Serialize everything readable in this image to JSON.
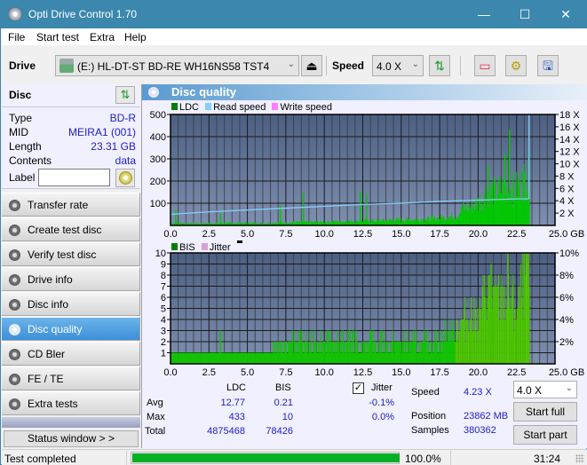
{
  "window": {
    "title": "Opti Drive Control 1.70",
    "controls": {
      "minimize": "—",
      "maximize": "☐",
      "close": "✕"
    }
  },
  "menu": [
    "File",
    "Start test",
    "Extra",
    "Help"
  ],
  "toolbar": {
    "drive_label": "Drive",
    "drive_value": "(E:)  HL-DT-ST BD-RE  WH16NS58 TST4",
    "speed_label": "Speed",
    "speed_value": "4.0 X",
    "icons": [
      "eject-icon",
      "refresh-icon",
      "erase-icon",
      "settings-icon",
      "save-icon"
    ]
  },
  "disc": {
    "header": "Disc",
    "rows": [
      {
        "key": "Type",
        "value": "BD-R"
      },
      {
        "key": "MID",
        "value": "MEIRA1 (001)"
      },
      {
        "key": "Length",
        "value": "23.31 GB"
      },
      {
        "key": "Contents",
        "value": "data"
      }
    ],
    "label_key": "Label",
    "label_value": ""
  },
  "nav": [
    {
      "label": "Transfer rate",
      "active": false
    },
    {
      "label": "Create test disc",
      "active": false
    },
    {
      "label": "Verify test disc",
      "active": false
    },
    {
      "label": "Drive info",
      "active": false
    },
    {
      "label": "Disc info",
      "active": false
    },
    {
      "label": "Disc quality",
      "active": true
    },
    {
      "label": "CD Bler",
      "active": false
    },
    {
      "label": "FE / TE",
      "active": false
    },
    {
      "label": "Extra tests",
      "active": false
    }
  ],
  "status_window_button": "Status window > >",
  "panel_title": "Disc quality",
  "legend_top": [
    {
      "label": "LDC",
      "color": "#008000"
    },
    {
      "label": "Read speed",
      "color": "#87cefa"
    },
    {
      "label": "Write speed",
      "color": "#ff80ff"
    }
  ],
  "legend_bottom": [
    {
      "label": "BIS",
      "color": "#008000"
    },
    {
      "label": "Jitter",
      "color": "#d8a0d8"
    }
  ],
  "chart_data": [
    {
      "type": "bar",
      "title": "LDC / Read speed",
      "xlabel": "GB",
      "ylabel": "",
      "xlim": [
        0,
        25
      ],
      "ylim": [
        0,
        500
      ],
      "y2lim": [
        0,
        18
      ],
      "x_ticks": [
        "0.0",
        "2.5",
        "5.0",
        "7.5",
        "10.0",
        "12.5",
        "15.0",
        "17.5",
        "20.0",
        "22.5",
        "25.0 GB"
      ],
      "y_ticks": [
        "100",
        "200",
        "300",
        "400",
        "500"
      ],
      "y2_ticks": [
        "2 X",
        "4 X",
        "6 X",
        "8 X",
        "10 X",
        "12 X",
        "14 X",
        "16 X",
        "18 X"
      ],
      "grid": true,
      "legend": "top-left",
      "series": [
        {
          "name": "LDC",
          "color": "#00c000",
          "x": [
            0.0,
            0.5,
            1.0,
            1.5,
            2.0,
            2.5,
            3.0,
            3.5,
            4.0,
            4.5,
            5.0,
            5.5,
            6.0,
            6.5,
            7.0,
            7.5,
            8.0,
            8.5,
            9.0,
            9.5,
            10.0,
            10.5,
            11.0,
            11.5,
            12.0,
            12.5,
            13.0,
            13.5,
            14.0,
            14.5,
            15.0,
            15.5,
            16.0,
            16.5,
            17.0,
            17.5,
            18.0,
            18.5,
            19.0,
            19.5,
            20.0,
            20.5,
            21.0,
            21.5,
            22.0,
            22.5,
            23.0,
            23.31
          ],
          "values": [
            10,
            12,
            8,
            10,
            8,
            10,
            10,
            12,
            10,
            12,
            10,
            12,
            10,
            12,
            12,
            14,
            14,
            15,
            14,
            16,
            16,
            18,
            18,
            20,
            20,
            20,
            22,
            22,
            24,
            26,
            26,
            28,
            28,
            30,
            30,
            35,
            40,
            45,
            80,
            90,
            110,
            150,
            160,
            170,
            160,
            180,
            220,
            240
          ],
          "spikes": [
            {
              "x": 0.3,
              "value": 70
            },
            {
              "x": 3.2,
              "value": 55
            },
            {
              "x": 7.1,
              "value": 90
            },
            {
              "x": 8.6,
              "value": 150
            },
            {
              "x": 12.3,
              "value": 155
            },
            {
              "x": 12.7,
              "value": 145
            },
            {
              "x": 20.6,
              "value": 270
            },
            {
              "x": 22.0,
              "value": 430
            },
            {
              "x": 21.7,
              "value": 320
            }
          ]
        },
        {
          "name": "Read speed",
          "color": "#87cefa",
          "axis": "right",
          "x": [
            0.0,
            2.5,
            5.0,
            7.5,
            10.0,
            12.5,
            15.0,
            17.5,
            20.0,
            22.5,
            23.31
          ],
          "values": [
            1.8,
            2.2,
            2.5,
            2.8,
            3.1,
            3.4,
            3.6,
            3.9,
            4.1,
            4.3,
            4.3
          ],
          "end_spike": 18
        },
        {
          "name": "Write speed",
          "color": "#ff80ff",
          "values": []
        }
      ]
    },
    {
      "type": "bar",
      "title": "BIS / Jitter",
      "xlabel": "GB",
      "xlim": [
        0,
        25
      ],
      "ylim": [
        0,
        10
      ],
      "y2lim": [
        0,
        10
      ],
      "x_ticks": [
        "0.0",
        "2.5",
        "5.0",
        "7.5",
        "10.0",
        "12.5",
        "15.0",
        "17.5",
        "20.0",
        "22.5",
        "25.0 GB"
      ],
      "y_ticks": [
        "1",
        "2",
        "3",
        "4",
        "5",
        "6",
        "7",
        "8",
        "9",
        "10"
      ],
      "y2_ticks": [
        "2%",
        "4%",
        "6%",
        "8%",
        "10%"
      ],
      "grid": true,
      "legend": "top-left",
      "series": [
        {
          "name": "BIS",
          "color": "#00c000",
          "x": [
            0.0,
            1.0,
            2.0,
            3.0,
            4.0,
            5.0,
            6.0,
            7.0,
            8.0,
            9.0,
            10.0,
            11.0,
            12.0,
            13.0,
            14.0,
            15.0,
            16.0,
            17.0,
            18.0,
            18.5,
            19.0,
            19.5,
            20.0,
            20.5,
            21.0,
            21.5,
            22.0,
            22.5,
            23.0,
            23.31
          ],
          "values": [
            1,
            1,
            1,
            1,
            1,
            1,
            1,
            2,
            2,
            2,
            2,
            2,
            2,
            2,
            2,
            2,
            2,
            2,
            3,
            3,
            4,
            5,
            4,
            7,
            6,
            6,
            6,
            5,
            8,
            8
          ],
          "spikes": [
            {
              "x": 3.2,
              "value": 3
            },
            {
              "x": 11.6,
              "value": 3
            },
            {
              "x": 12.0,
              "value": 3
            },
            {
              "x": 20.8,
              "value": 9
            },
            {
              "x": 21.9,
              "value": 10
            },
            {
              "x": 23.1,
              "value": 10
            }
          ]
        },
        {
          "name": "Jitter",
          "color": "#d8a0d8",
          "values": []
        }
      ]
    }
  ],
  "stats": {
    "col_ldc": "LDC",
    "col_bis": "BIS",
    "rows": [
      {
        "label": "Avg",
        "ldc": "12.77",
        "bis": "0.21",
        "jitter": "-0.1%"
      },
      {
        "label": "Max",
        "ldc": "433",
        "bis": "10",
        "jitter": "0.0%"
      },
      {
        "label": "Total",
        "ldc": "4875468",
        "bis": "78426",
        "jitter": ""
      }
    ],
    "jitter_label": "Jitter",
    "jitter_checked": true,
    "speed_label": "Speed",
    "speed_value": "4.23 X",
    "position_label": "Position",
    "position_value": "23862 MB",
    "samples_label": "Samples",
    "samples_value": "380362",
    "speed_select": "4.0 X",
    "start_full": "Start full",
    "start_part": "Start part"
  },
  "statusbar": {
    "text": "Test completed",
    "progress": 100.0,
    "progress_text": "100.0%",
    "time": "31:24"
  }
}
